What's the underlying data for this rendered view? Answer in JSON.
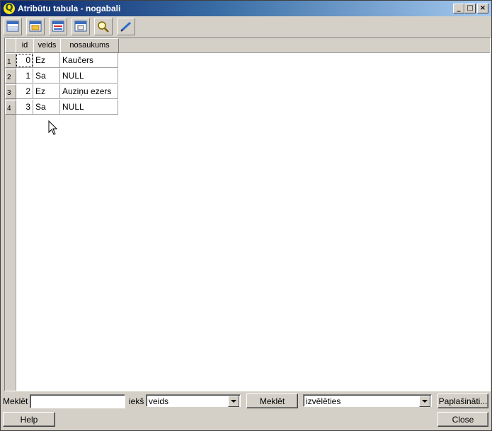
{
  "window": {
    "title": "Atribūtu tabula - nogabali",
    "app_icon_letter": "Q",
    "controls": {
      "minimize": "_",
      "maximize": "□",
      "close": "×"
    }
  },
  "toolbar": {
    "buttons": [
      {
        "name": "table-icon"
      },
      {
        "name": "table-select-icon"
      },
      {
        "name": "table-invert-icon"
      },
      {
        "name": "table-copy-icon"
      },
      {
        "name": "zoom-to-selection-icon"
      },
      {
        "name": "edit-pencil-icon"
      }
    ]
  },
  "table": {
    "columns": [
      "id",
      "veids",
      "nosaukums"
    ],
    "row_headers": [
      "1",
      "2",
      "3",
      "4"
    ],
    "rows": [
      [
        "0",
        "Ez",
        "Kaučers"
      ],
      [
        "1",
        "Sa",
        "NULL"
      ],
      [
        "2",
        "Ez",
        "Auziņu ezers"
      ],
      [
        "3",
        "Sa",
        "NULL"
      ]
    ]
  },
  "search": {
    "label": "Meklēt",
    "value": "",
    "in_label": "iekš",
    "field_value": "veids",
    "search_button": "Meklēt",
    "mode_value": "izvēlēties",
    "advanced_button": "Paplašināti..."
  },
  "footer": {
    "help_button": "Help",
    "close_button": "Close"
  }
}
